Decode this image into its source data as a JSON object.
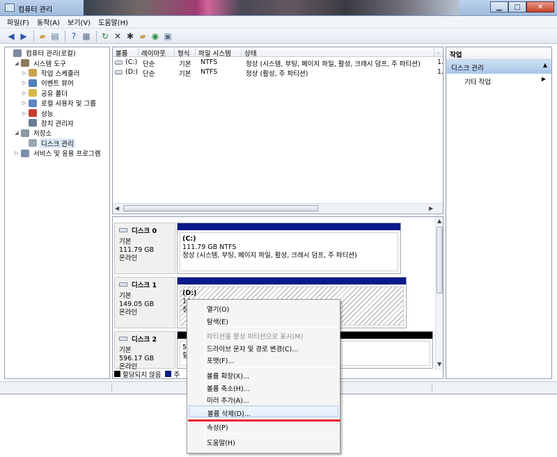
{
  "window": {
    "title": "컴퓨터 관리"
  },
  "menu": [
    "파일(F)",
    "동작(A)",
    "보기(V)",
    "도움말(H)"
  ],
  "toolbar_icons": [
    "back-arrow-icon",
    "forward-arrow-icon",
    "up-folder-icon",
    "show-tree-icon",
    "help-icon",
    "properties-icon",
    "refresh-icon",
    "delete-icon",
    "settings-icon",
    "open-icon",
    "search-icon",
    "export-icon"
  ],
  "tree": [
    {
      "label": "컴퓨터 관리(로컬)",
      "indent": 0,
      "expander": "",
      "icon_color": "#7a8aa0"
    },
    {
      "label": "시스템 도구",
      "indent": 1,
      "expander": "◢",
      "icon_color": "#8c7a5a"
    },
    {
      "label": "작업 스케줄러",
      "indent": 2,
      "expander": "▷",
      "icon_color": "#c9a24c"
    },
    {
      "label": "이벤트 뷰어",
      "indent": 2,
      "expander": "▷",
      "icon_color": "#4f7fb8"
    },
    {
      "label": "공유 폴더",
      "indent": 2,
      "expander": "▷",
      "icon_color": "#d9b74d"
    },
    {
      "label": "로컬 사용자 및 그룹",
      "indent": 2,
      "expander": "▷",
      "icon_color": "#5f87c5"
    },
    {
      "label": "성능",
      "indent": 2,
      "expander": "▷",
      "icon_color": "#c63b2f"
    },
    {
      "label": "장치 관리자",
      "indent": 2,
      "expander": "",
      "icon_color": "#6a7d95"
    },
    {
      "label": "저장소",
      "indent": 1,
      "expander": "◢",
      "icon_color": "#8b96a6"
    },
    {
      "label": "디스크 관리",
      "indent": 2,
      "expander": "",
      "icon_color": "#9aa4b3",
      "selected": true
    },
    {
      "label": "서비스 및 응용 프로그램",
      "indent": 1,
      "expander": "▷",
      "icon_color": "#7a8fab"
    }
  ],
  "volume_list": {
    "columns": [
      "볼륨",
      "레이아웃",
      "형식",
      "파일 시스템",
      "상태",
      "."
    ],
    "rows": [
      {
        "volume": "(C:)",
        "layout": "단순",
        "type": "기본",
        "fs": "NTFS",
        "status": "정상 (시스템, 부팅, 페이지 파일, 활성, 크래시 덤프, 주 파티션)",
        "extra": "1."
      },
      {
        "volume": "(D:)",
        "layout": "단순",
        "type": "기본",
        "fs": "NTFS",
        "status": "정상 (활성, 주 파티션)",
        "extra": "1."
      }
    ]
  },
  "disks": [
    {
      "name": "디스크 0",
      "kind": "기본",
      "size": "111.79 GB",
      "state": "온라인",
      "partition": {
        "label": "(C:)",
        "line1": "111.79 GB NTFS",
        "line2": "정상 (시스템, 부팅, 페이지 파일, 활성, 크래시 덤프, 주 파티션)"
      }
    },
    {
      "name": "디스크 1",
      "kind": "기본",
      "size": "149.05 GB",
      "state": "온라인",
      "partition": {
        "label": "(D:)",
        "line1": "14",
        "line2": "정"
      }
    },
    {
      "name": "디스크 2",
      "kind": "기본",
      "size": "596.17 GB",
      "state": "온라인",
      "partition": {
        "label": "",
        "line1": "5",
        "line2": "할"
      }
    }
  ],
  "legend": [
    {
      "label": "할당되지 않음",
      "color": "#000000"
    },
    {
      "label": "주",
      "color": "#0b1a8a"
    }
  ],
  "actions": {
    "header": "작업",
    "section": "디스크 관리",
    "item": "기타 작업"
  },
  "context_menu": [
    {
      "label": "열기(O)",
      "disabled": false
    },
    {
      "label": "탐색(E)",
      "disabled": false
    },
    {
      "sep": true
    },
    {
      "label": "파티션을 활성 파티션으로 표시(M)",
      "disabled": true
    },
    {
      "label": "드라이브 문자 및 경로 변경(C)...",
      "disabled": false
    },
    {
      "label": "포맷(F)...",
      "disabled": false
    },
    {
      "sep": true
    },
    {
      "label": "볼륨 확장(X)...",
      "disabled": false
    },
    {
      "label": "볼륨 축소(H)...",
      "disabled": false
    },
    {
      "label": "미러 추가(A)...",
      "disabled": false
    },
    {
      "label": "볼륨 삭제(D)...",
      "disabled": false,
      "hover": true
    },
    {
      "sep": true
    },
    {
      "label": "속성(P)",
      "disabled": false
    },
    {
      "sep": true
    },
    {
      "label": "도움말(H)",
      "disabled": false
    }
  ],
  "colors": {
    "primary_partition": "#0b1a8a",
    "unallocated": "#000000",
    "highlight_mark": "#e8242c",
    "selection": "#dde8f5"
  }
}
